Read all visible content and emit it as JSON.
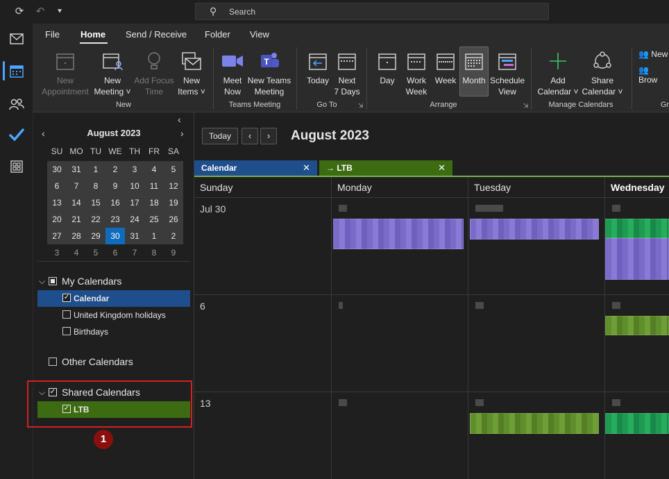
{
  "titlebar": {
    "search_placeholder": "Search"
  },
  "ribbon": {
    "tabs": [
      "File",
      "Home",
      "Send / Receive",
      "Folder",
      "View"
    ],
    "active_tab": "Home",
    "buttons": {
      "new_appointment": [
        "New",
        "Appointment"
      ],
      "new_meeting": [
        "New",
        "Meeting ˅"
      ],
      "add_focus_time": [
        "Add Focus",
        "Time"
      ],
      "new_items": [
        "New",
        "Items ˅"
      ],
      "meet_now": [
        "Meet",
        "Now"
      ],
      "new_teams_meeting": [
        "New Teams",
        "Meeting"
      ],
      "today": [
        "Today",
        ""
      ],
      "next_7_days": [
        "Next",
        "7 Days"
      ],
      "day": [
        "Day",
        ""
      ],
      "work_week": [
        "Work",
        "Week"
      ],
      "week": [
        "Week",
        ""
      ],
      "month": [
        "Month",
        ""
      ],
      "schedule_view": [
        "Schedule",
        "View"
      ],
      "add_calendar": [
        "Add",
        "Calendar ˅"
      ],
      "share_calendar": [
        "Share",
        "Calendar ˅"
      ],
      "new_group": "New",
      "browse_groups": "Brow"
    },
    "groups": {
      "new": "New",
      "teams_meeting": "Teams Meeting",
      "go_to": "Go To",
      "arrange": "Arrange",
      "manage_calendars": "Manage Calendars",
      "groups_partial": "Gr"
    }
  },
  "minical": {
    "title": "August 2023",
    "dow": [
      "SU",
      "MO",
      "TU",
      "WE",
      "TH",
      "FR",
      "SA"
    ],
    "weeks": [
      [
        "30",
        "31",
        "1",
        "2",
        "3",
        "4",
        "5"
      ],
      [
        "6",
        "7",
        "8",
        "9",
        "10",
        "11",
        "12"
      ],
      [
        "13",
        "14",
        "15",
        "16",
        "17",
        "18",
        "19"
      ],
      [
        "20",
        "21",
        "22",
        "23",
        "24",
        "25",
        "26"
      ],
      [
        "27",
        "28",
        "29",
        "30",
        "31",
        "1",
        "2"
      ],
      [
        "3",
        "4",
        "5",
        "6",
        "7",
        "8",
        "9"
      ]
    ],
    "today": "30"
  },
  "folders": {
    "my_calendars": "My Calendars",
    "calendar": "Calendar",
    "uk_holidays": "United Kingdom holidays",
    "birthdays": "Birthdays",
    "other_calendars": "Other Calendars",
    "shared_calendars": "Shared Calendars",
    "ltb": "LTB",
    "callout_number": "1"
  },
  "main": {
    "today_button": "Today",
    "prev": "‹",
    "next": "›",
    "month_title": "August 2023",
    "tabs": [
      {
        "label": "Calendar",
        "close": "✕"
      },
      {
        "label": "→  LTB",
        "close": "✕"
      }
    ],
    "dow": [
      "Sunday",
      "Monday",
      "Tuesday",
      "Wednesday"
    ],
    "week_labels": [
      "Jul 30",
      "6",
      "13"
    ]
  },
  "colors": {
    "accent_blue": "#1e4e8c",
    "shared_green": "#3c6b12",
    "highlight_red": "#d32020"
  }
}
